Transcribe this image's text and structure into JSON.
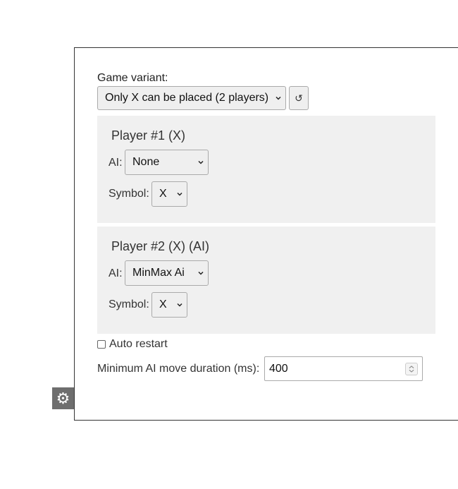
{
  "settings_tab": {
    "icon": "gear-icon"
  },
  "variant": {
    "label": "Game variant:",
    "selected": "Only X can be placed (2 players)",
    "reset_icon": "↺"
  },
  "players": [
    {
      "title": "Player #1 (X)",
      "ai_label": "AI:",
      "ai_selected": "None",
      "symbol_label": "Symbol:",
      "symbol_selected": "X"
    },
    {
      "title": "Player #2 (X) (AI)",
      "ai_label": "AI:",
      "ai_selected": "MinMax Ai",
      "symbol_label": "Symbol:",
      "symbol_selected": "X"
    }
  ],
  "auto_restart": {
    "label": "Auto restart",
    "checked": false
  },
  "min_duration": {
    "label": "Minimum AI move duration (ms):",
    "value": "400"
  }
}
